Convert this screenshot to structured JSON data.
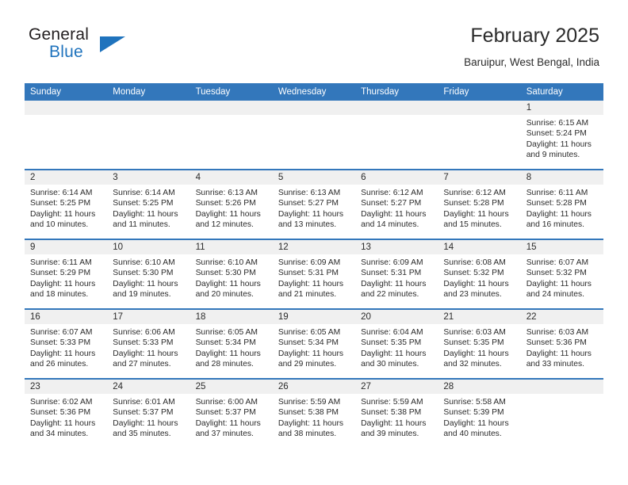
{
  "brand": {
    "name_part1": "General",
    "name_part2": "Blue",
    "logo_icon": "triangle-logo-icon"
  },
  "header": {
    "title": "February 2025",
    "location": "Baruipur, West Bengal, India"
  },
  "calendar": {
    "weekday_headers": [
      "Sunday",
      "Monday",
      "Tuesday",
      "Wednesday",
      "Thursday",
      "Friday",
      "Saturday"
    ],
    "colors": {
      "header_blue": "#3377bb",
      "daynum_band": "#f0f0f0",
      "text": "#2b2b2b",
      "brand_blue": "#1f73bd"
    },
    "weeks": [
      [
        {
          "empty": true
        },
        {
          "empty": true
        },
        {
          "empty": true
        },
        {
          "empty": true
        },
        {
          "empty": true
        },
        {
          "empty": true
        },
        {
          "day": "1",
          "sunrise": "Sunrise: 6:15 AM",
          "sunset": "Sunset: 5:24 PM",
          "daylight": "Daylight: 11 hours and 9 minutes."
        }
      ],
      [
        {
          "day": "2",
          "sunrise": "Sunrise: 6:14 AM",
          "sunset": "Sunset: 5:25 PM",
          "daylight": "Daylight: 11 hours and 10 minutes."
        },
        {
          "day": "3",
          "sunrise": "Sunrise: 6:14 AM",
          "sunset": "Sunset: 5:25 PM",
          "daylight": "Daylight: 11 hours and 11 minutes."
        },
        {
          "day": "4",
          "sunrise": "Sunrise: 6:13 AM",
          "sunset": "Sunset: 5:26 PM",
          "daylight": "Daylight: 11 hours and 12 minutes."
        },
        {
          "day": "5",
          "sunrise": "Sunrise: 6:13 AM",
          "sunset": "Sunset: 5:27 PM",
          "daylight": "Daylight: 11 hours and 13 minutes."
        },
        {
          "day": "6",
          "sunrise": "Sunrise: 6:12 AM",
          "sunset": "Sunset: 5:27 PM",
          "daylight": "Daylight: 11 hours and 14 minutes."
        },
        {
          "day": "7",
          "sunrise": "Sunrise: 6:12 AM",
          "sunset": "Sunset: 5:28 PM",
          "daylight": "Daylight: 11 hours and 15 minutes."
        },
        {
          "day": "8",
          "sunrise": "Sunrise: 6:11 AM",
          "sunset": "Sunset: 5:28 PM",
          "daylight": "Daylight: 11 hours and 16 minutes."
        }
      ],
      [
        {
          "day": "9",
          "sunrise": "Sunrise: 6:11 AM",
          "sunset": "Sunset: 5:29 PM",
          "daylight": "Daylight: 11 hours and 18 minutes."
        },
        {
          "day": "10",
          "sunrise": "Sunrise: 6:10 AM",
          "sunset": "Sunset: 5:30 PM",
          "daylight": "Daylight: 11 hours and 19 minutes."
        },
        {
          "day": "11",
          "sunrise": "Sunrise: 6:10 AM",
          "sunset": "Sunset: 5:30 PM",
          "daylight": "Daylight: 11 hours and 20 minutes."
        },
        {
          "day": "12",
          "sunrise": "Sunrise: 6:09 AM",
          "sunset": "Sunset: 5:31 PM",
          "daylight": "Daylight: 11 hours and 21 minutes."
        },
        {
          "day": "13",
          "sunrise": "Sunrise: 6:09 AM",
          "sunset": "Sunset: 5:31 PM",
          "daylight": "Daylight: 11 hours and 22 minutes."
        },
        {
          "day": "14",
          "sunrise": "Sunrise: 6:08 AM",
          "sunset": "Sunset: 5:32 PM",
          "daylight": "Daylight: 11 hours and 23 minutes."
        },
        {
          "day": "15",
          "sunrise": "Sunrise: 6:07 AM",
          "sunset": "Sunset: 5:32 PM",
          "daylight": "Daylight: 11 hours and 24 minutes."
        }
      ],
      [
        {
          "day": "16",
          "sunrise": "Sunrise: 6:07 AM",
          "sunset": "Sunset: 5:33 PM",
          "daylight": "Daylight: 11 hours and 26 minutes."
        },
        {
          "day": "17",
          "sunrise": "Sunrise: 6:06 AM",
          "sunset": "Sunset: 5:33 PM",
          "daylight": "Daylight: 11 hours and 27 minutes."
        },
        {
          "day": "18",
          "sunrise": "Sunrise: 6:05 AM",
          "sunset": "Sunset: 5:34 PM",
          "daylight": "Daylight: 11 hours and 28 minutes."
        },
        {
          "day": "19",
          "sunrise": "Sunrise: 6:05 AM",
          "sunset": "Sunset: 5:34 PM",
          "daylight": "Daylight: 11 hours and 29 minutes."
        },
        {
          "day": "20",
          "sunrise": "Sunrise: 6:04 AM",
          "sunset": "Sunset: 5:35 PM",
          "daylight": "Daylight: 11 hours and 30 minutes."
        },
        {
          "day": "21",
          "sunrise": "Sunrise: 6:03 AM",
          "sunset": "Sunset: 5:35 PM",
          "daylight": "Daylight: 11 hours and 32 minutes."
        },
        {
          "day": "22",
          "sunrise": "Sunrise: 6:03 AM",
          "sunset": "Sunset: 5:36 PM",
          "daylight": "Daylight: 11 hours and 33 minutes."
        }
      ],
      [
        {
          "day": "23",
          "sunrise": "Sunrise: 6:02 AM",
          "sunset": "Sunset: 5:36 PM",
          "daylight": "Daylight: 11 hours and 34 minutes."
        },
        {
          "day": "24",
          "sunrise": "Sunrise: 6:01 AM",
          "sunset": "Sunset: 5:37 PM",
          "daylight": "Daylight: 11 hours and 35 minutes."
        },
        {
          "day": "25",
          "sunrise": "Sunrise: 6:00 AM",
          "sunset": "Sunset: 5:37 PM",
          "daylight": "Daylight: 11 hours and 37 minutes."
        },
        {
          "day": "26",
          "sunrise": "Sunrise: 5:59 AM",
          "sunset": "Sunset: 5:38 PM",
          "daylight": "Daylight: 11 hours and 38 minutes."
        },
        {
          "day": "27",
          "sunrise": "Sunrise: 5:59 AM",
          "sunset": "Sunset: 5:38 PM",
          "daylight": "Daylight: 11 hours and 39 minutes."
        },
        {
          "day": "28",
          "sunrise": "Sunrise: 5:58 AM",
          "sunset": "Sunset: 5:39 PM",
          "daylight": "Daylight: 11 hours and 40 minutes."
        },
        {
          "empty": true
        }
      ]
    ]
  }
}
